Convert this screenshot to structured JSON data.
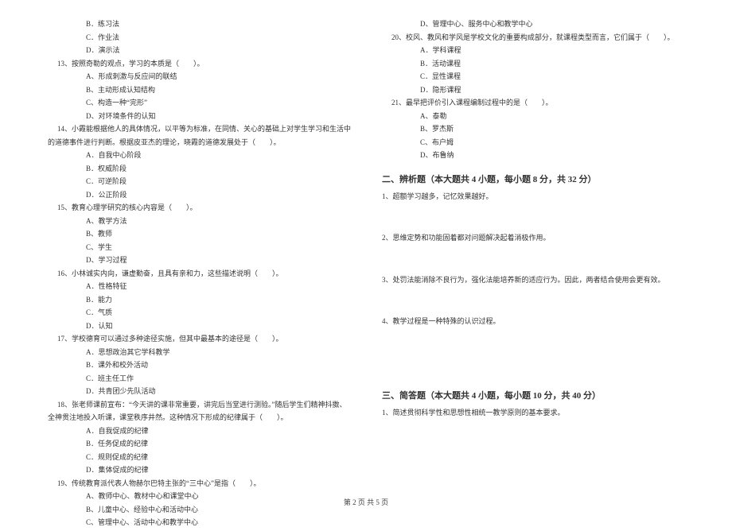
{
  "leftCol": {
    "q12opts": [
      "B．练习法",
      "C．作业法",
      "D．演示法"
    ],
    "q13": {
      "stem": "13、按照奇勒的观点，学习的本质是（　　）。",
      "opts": [
        "A、形成刺激与反应间的联结",
        "B、主动形成认知结构",
        "C、构造一种“完形”",
        "D、对环境条件的认知"
      ]
    },
    "q14": {
      "stem_a": "14、小霞能根据他人的具体情况，以平等为标准，在同情、关心的基础上对学生学习和生活中",
      "stem_b": "的道德事件进行判断。根据皮亚杰的理论，晓霞的道德发展处于（　　）。",
      "opts": [
        "A．自我中心阶段",
        "B．权威阶段",
        "C．可逆阶段",
        "D．公正阶段"
      ]
    },
    "q15": {
      "stem": "15、教育心理学研究的核心内容是（　　）。",
      "opts": [
        "A、教学方法",
        "B、教师",
        "C、学生",
        "D、学习过程"
      ]
    },
    "q16": {
      "stem": "16、小林诚实内向，谦虚勤奋，且具有亲和力，这些描述说明（　　）。",
      "opts": [
        "A．性格特征",
        "B．能力",
        "C．气质",
        "D．认知"
      ]
    },
    "q17": {
      "stem": "17、学校德育可以通过多种途径实施，但其中最基本的途径是（　　）。",
      "opts": [
        "A．思想政治其它学科教学",
        "B．课外和校外活动",
        "C．班主任工作",
        "D．共青团少先队活动"
      ]
    },
    "q18": {
      "stem_a": "18、张老师课前宣布：“今天讲的课非常重要，讲完后当堂进行测验。”随后学生们精神抖擞、",
      "stem_b": "全神贯注地投入听课，课堂秩序井然。这种情况下形成的纪律属于（　　）。",
      "opts": [
        "A．自我促成的纪律",
        "B．任务促成的纪律",
        "C．规则促成的纪律",
        "D．集体促成的纪律"
      ]
    },
    "q19": {
      "stem": "19、传统教育派代表人物赫尔巴特主张的“三中心”是指（　　）。",
      "opts": [
        "A、教师中心、教材中心和课堂中心",
        "B、儿童中心、经验中心和活动中心",
        "C、管理中心、活动中心和教学中心"
      ]
    }
  },
  "rightCol": {
    "q19d": "D、管理中心、服务中心和教学中心",
    "q20": {
      "stem": "20、校风、教风和学风是学校文化的重要构成部分，就课程类型而言，它们属于（　　）。",
      "opts": [
        "A．学科课程",
        "B．活动课程",
        "C．显性课程",
        "D．隐形课程"
      ]
    },
    "q21": {
      "stem": "21、最早把评价引入课程编制过程中的是（　　）。",
      "opts": [
        "A、泰勒",
        "B、罗杰斯",
        "C、布户姆",
        "D、布鲁纳"
      ]
    },
    "section2": {
      "title": "二、辨析题（本大题共 4 小题，每小题 8 分，共 32 分）",
      "items": [
        "1、超额学习越多，记忆效果越好。",
        "2、思维定势和功能固着都对问题解决起着消极作用。",
        "3、处罚法能消除不良行为，强化法能培养新的适应行为。因此，两者结合使用会更有效。",
        "4、教学过程是一种特殊的认识过程。"
      ]
    },
    "section3": {
      "title": "三、简答题（本大题共 4 小题，每小题 10 分，共 40 分）",
      "items": [
        "1、简述贯彻科学性和思想性相统一教学原则的基本要求。"
      ]
    }
  },
  "footer": "第 2 页 共 5 页"
}
